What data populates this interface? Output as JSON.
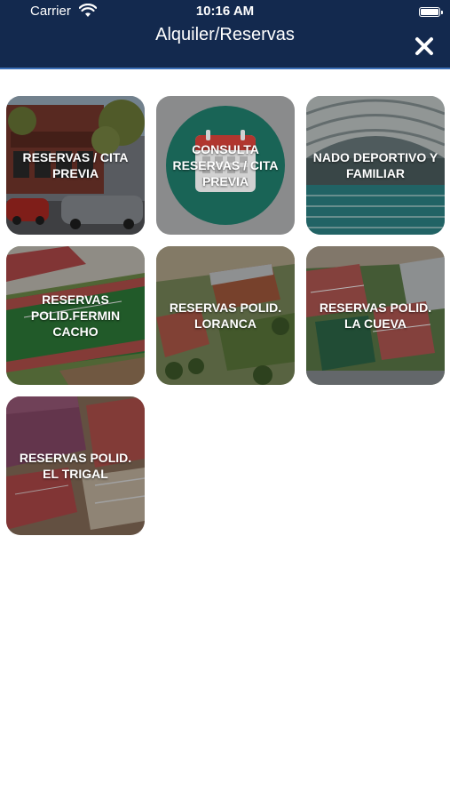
{
  "status_bar": {
    "carrier": "Carrier",
    "time": "10:16 AM"
  },
  "header": {
    "title": "Alquiler/Reservas",
    "close_icon": "close-icon",
    "background_color": "#13294e"
  },
  "tiles": [
    {
      "label": "RESERVAS / CITA\nPREVIA",
      "image": "building-street-photo"
    },
    {
      "label": "CONSULTA\nRESERVAS / CITA\nPREVIA",
      "image": "calendar-icon"
    },
    {
      "label": "NADO DEPORTIVO Y\nFAMILIAR",
      "image": "swimming-pool-photo"
    },
    {
      "label": "RESERVAS\nPOLID.FERMIN\nCACHO",
      "image": "sports-complex-aerial-photo"
    },
    {
      "label": "RESERVAS POLID.\nLORANCA",
      "image": "sports-hall-aerial-photo"
    },
    {
      "label": "RESERVAS POLID.\nLA CUEVA",
      "image": "tennis-courts-aerial-photo"
    },
    {
      "label": "RESERVAS POLID.\nEL TRIGAL",
      "image": "courts-aerial-photo"
    }
  ]
}
